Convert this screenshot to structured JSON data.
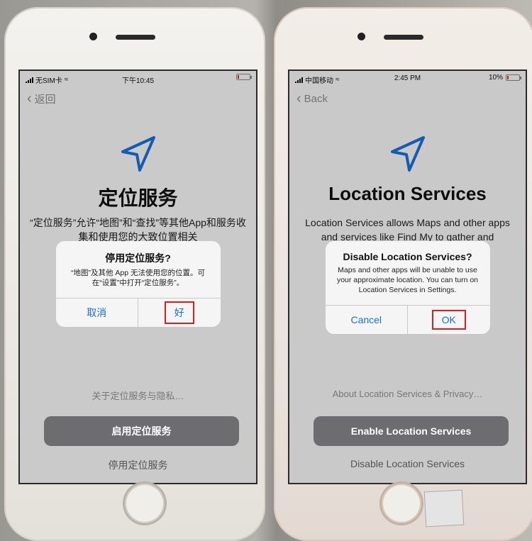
{
  "left": {
    "status": {
      "carrier": "无SIM卡",
      "time": "下午10:45"
    },
    "back": "返回",
    "title": "定位服务",
    "description": "“定位服务”允许“地图”和“查找”等其他App和服务收集和使用您的大致位置相关",
    "alert": {
      "title": "停用定位服务?",
      "message": "“地图”及其他 App 无法使用您的位置。可在“设置”中打开“定位服务”。",
      "cancel": "取消",
      "ok": "好"
    },
    "about": "关于定位服务与隐私…",
    "enable": "启用定位服务",
    "disable": "停用定位服务"
  },
  "right": {
    "status": {
      "carrier": "中国移动",
      "time": "2:45 PM",
      "battery": "10%"
    },
    "back": "Back",
    "title": "Location Services",
    "description": "Location Services allows Maps and other apps and services like Find My to gather and",
    "alert": {
      "title": "Disable Location Services?",
      "message": "Maps and other apps will be unable to use your approximate location. You can turn on Location Services in Settings.",
      "cancel": "Cancel",
      "ok": "OK"
    },
    "about": "About Location Services & Privacy…",
    "enable": "Enable Location Services",
    "disable": "Disable Location Services"
  },
  "colors": {
    "accent": "#1a6fd8",
    "highlight": "#d32020",
    "button_bg": "#6d6d70"
  }
}
